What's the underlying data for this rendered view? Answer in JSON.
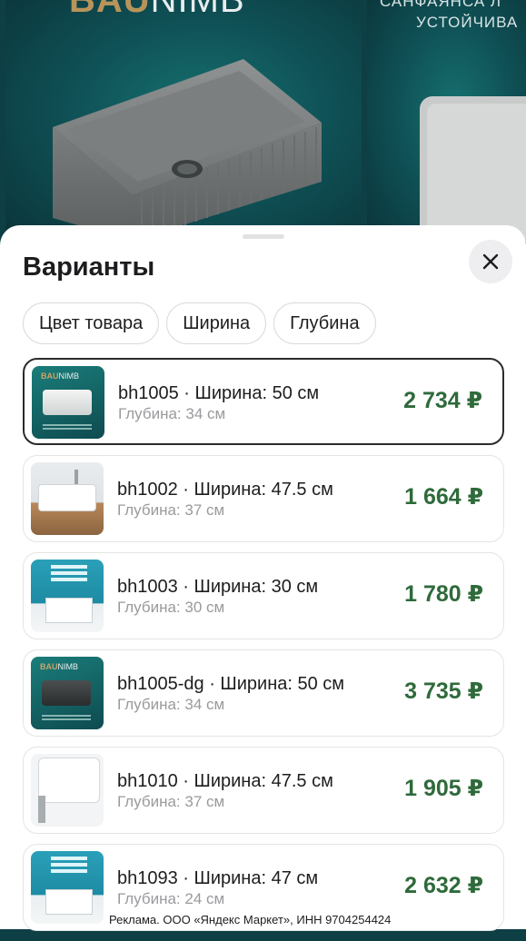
{
  "gallery": {
    "brand_prefix": "BAU",
    "brand_suffix": "NIMB",
    "slide2_line1": "САНФАЯНСА Л",
    "slide2_line2": "УСТОЙЧИВА"
  },
  "sheet": {
    "title": "Варианты",
    "close_icon": "close-icon"
  },
  "filters": [
    {
      "label": "Цвет товара"
    },
    {
      "label": "Ширина"
    },
    {
      "label": "Глубина"
    }
  ],
  "variants": [
    {
      "main": "bh1005 · Ширина: 50 см",
      "sub": "Глубина: 34 см",
      "price": "2 734 ₽",
      "selected": true
    },
    {
      "main": "bh1002 · Ширина: 47.5 см",
      "sub": "Глубина: 37 см",
      "price": "1 664 ₽"
    },
    {
      "main": "bh1003 · Ширина: 30 см",
      "sub": "Глубина: 30 см",
      "price": "1 780 ₽"
    },
    {
      "main": "bh1005-dg · Ширина: 50 см",
      "sub": "Глубина: 34 см",
      "price": "3 735 ₽"
    },
    {
      "main": "bh1010 · Ширина: 47.5 см",
      "sub": "Глубина: 37 см",
      "price": "1 905 ₽"
    },
    {
      "main": "bh1093 · Ширина: 47 см",
      "sub": "Глубина: 24 см",
      "price": "2 632 ₽"
    }
  ],
  "thumb_brand": {
    "prefix": "BAU",
    "suffix": "NIMB"
  },
  "ad_text": "Реклама. ООО «Яндекс Маркет», ИНН 9704254424",
  "colors": {
    "price": "#2f6a3b",
    "teal": "#0f5257",
    "selected_border": "#2b2b2e"
  }
}
